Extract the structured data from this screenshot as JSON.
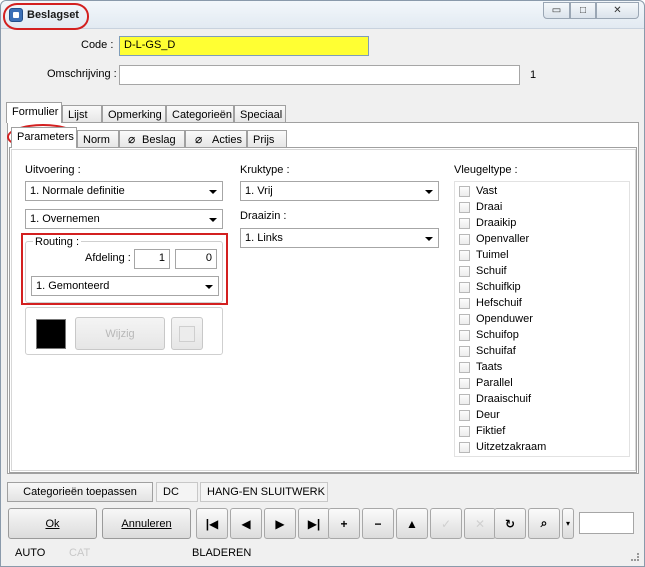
{
  "window": {
    "title": "Beslagset",
    "controls": {
      "minimize": "▭",
      "maximize": "□",
      "close": "✕"
    }
  },
  "header": {
    "code_label": "Code :",
    "code_value": "D-L-GS_D",
    "omschrijving_label": "Omschrijving :",
    "omschrijving_value": "",
    "counter": "1"
  },
  "main_tabs": [
    "Formulier",
    "Lijst",
    "Opmerking",
    "Categorieën",
    "Speciaal"
  ],
  "sub_tabs": [
    "Parameters",
    "Norm",
    "Beslag",
    "Acties",
    "Prijs"
  ],
  "parameters": {
    "uitvoering_label": "Uitvoering :",
    "uitvoering_value": "1.  Normale definitie",
    "overnemen_value": "1.  Overnemen",
    "routing_label": "Routing :",
    "afdeling_label": "Afdeling :",
    "afdeling_1": "1",
    "afdeling_2": "0",
    "gemonteerd_value": "1.  Gemonteerd",
    "wijzig_label": "Wijzig",
    "kruktype_label": "Kruktype :",
    "kruktype_value": "1.  Vrij",
    "draaizin_label": "Draaizin :",
    "draaizin_value": "1.  Links",
    "vleugeltype_label": "Vleugeltype :",
    "vleugeltypes": [
      "Vast",
      "Draai",
      "Draaikip",
      "Openvaller",
      "Tuimel",
      "Schuif",
      "Schuifkip",
      "Hefschuif",
      "Openduwer",
      "Schuifop",
      "Schuifaf",
      "Taats",
      "Parallel",
      "Draaischuif",
      "Deur",
      "Fiktief",
      "Uitzetzakraam"
    ]
  },
  "bottom": {
    "categorieen_button": "Categorieën toepassen",
    "dc": "DC",
    "hang": "HANG-EN SLUITWERK"
  },
  "actions": {
    "ok": "Ok",
    "annuleren": "Annuleren"
  },
  "nav_icons": [
    "first-icon",
    "prev-icon",
    "next-icon",
    "last-icon",
    "plus-icon",
    "minus-icon",
    "up-icon",
    "check-icon",
    "cancel-icon",
    "refresh-icon",
    "binoculars-icon"
  ],
  "nav_glyphs": [
    "|◀",
    "◀",
    "▶",
    "▶|",
    "+",
    "−",
    "▲",
    "✓",
    "✕",
    "↻",
    "⌕"
  ],
  "status": {
    "mode": "AUTO",
    "cat": "CAT",
    "state": "BLADEREN"
  }
}
